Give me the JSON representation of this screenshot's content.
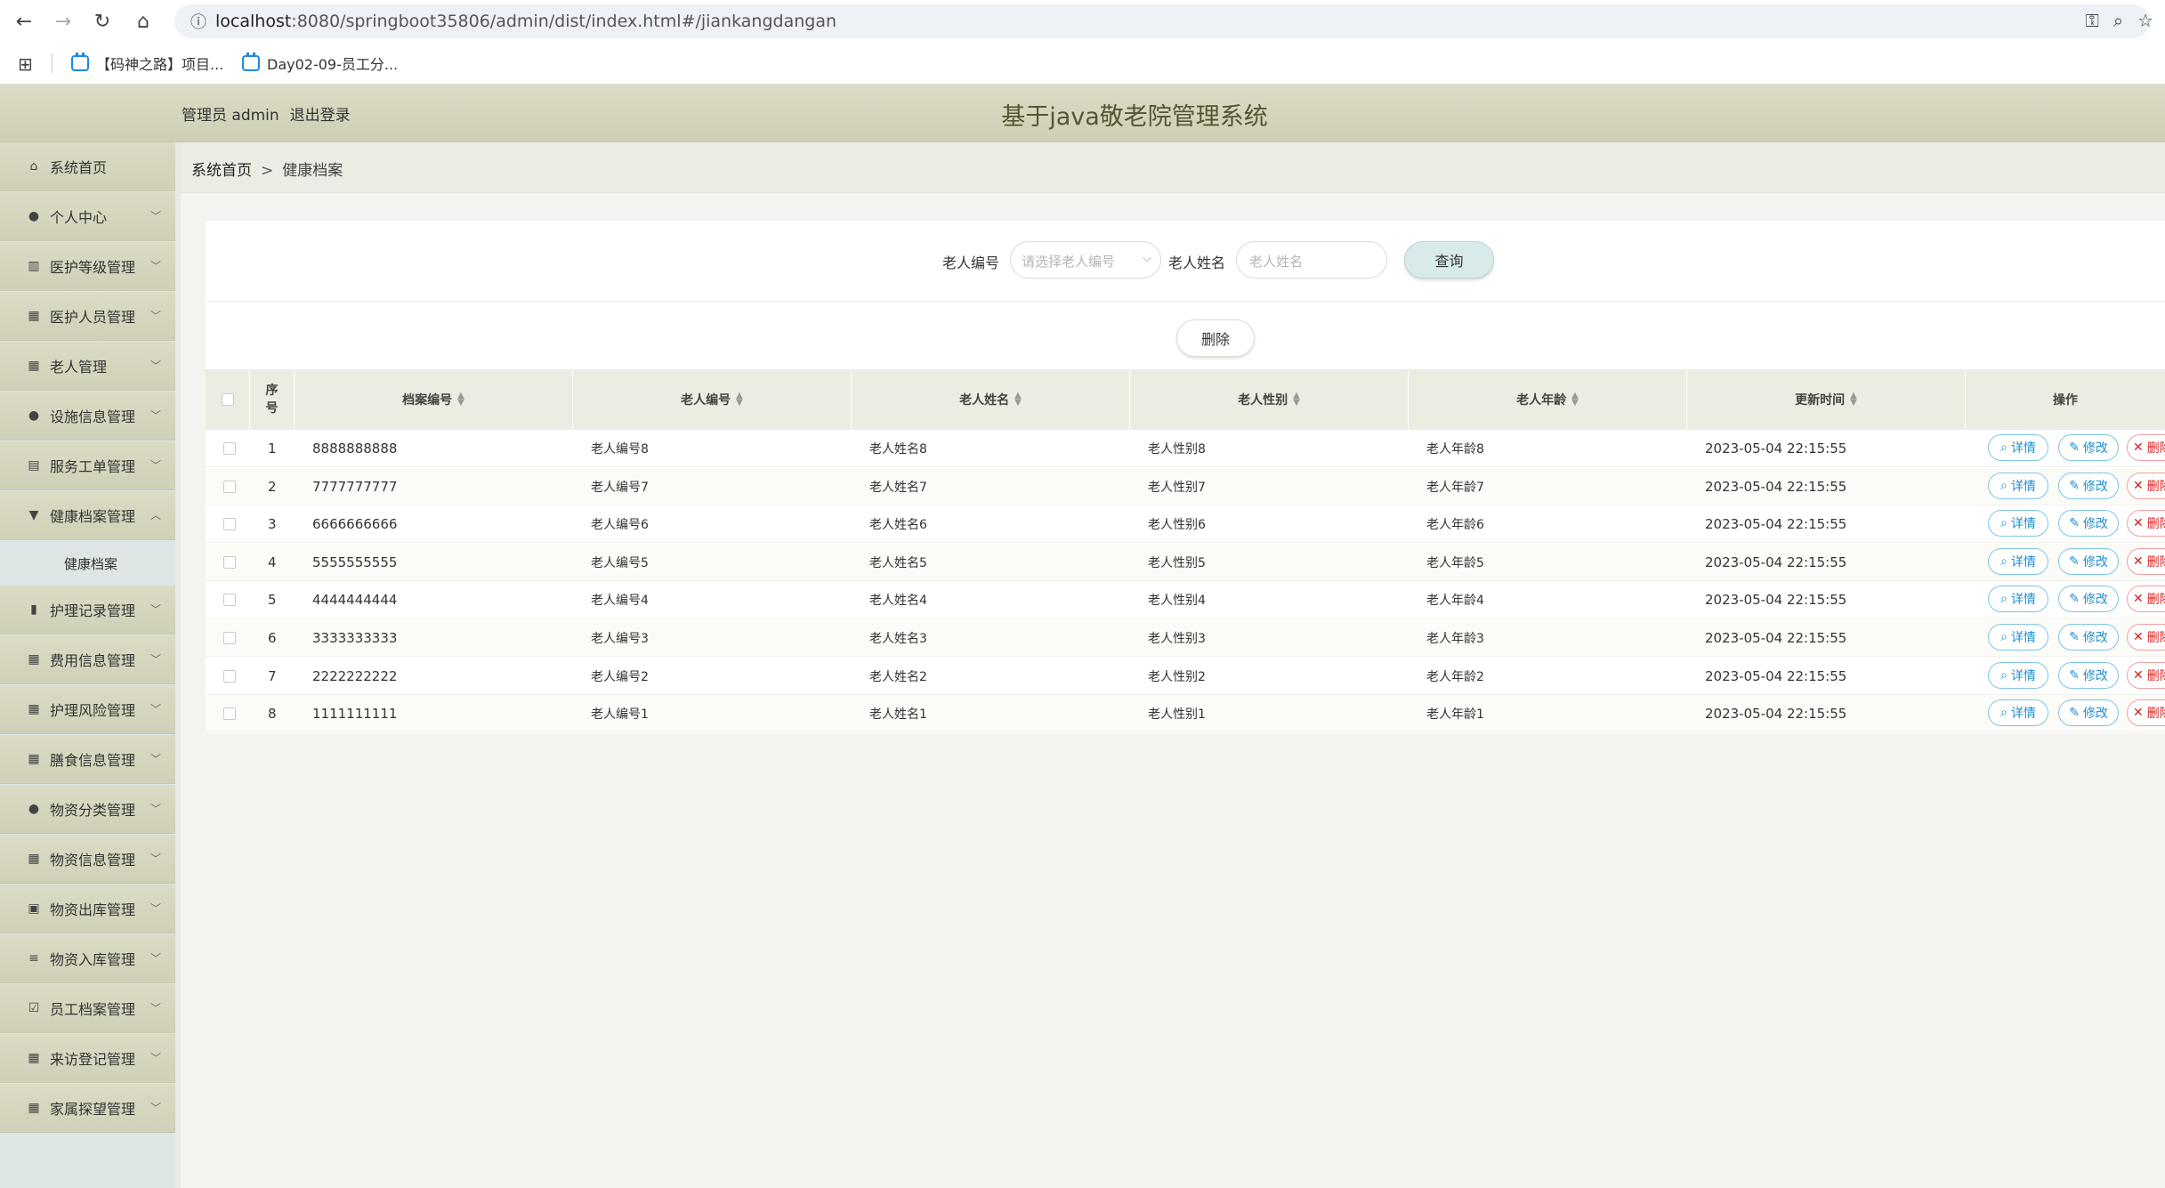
{
  "browser": {
    "url_host": "localhost",
    "url_rest": ":8080/springboot35806/admin/dist/index.html#/jiankangdangan",
    "bookmarks": [
      "【码神之路】项目...",
      "Day02-09-员工分..."
    ]
  },
  "header": {
    "user_role": "管理员 admin",
    "logout": "退出登录",
    "title": "基于java敬老院管理系统"
  },
  "sidebar": {
    "items": [
      {
        "label": "系统首页",
        "icon": "home-icon",
        "expandable": false
      },
      {
        "label": "个人中心",
        "icon": "user-icon",
        "expandable": true
      },
      {
        "label": "医护等级管理",
        "icon": "chart-icon",
        "expandable": true
      },
      {
        "label": "医护人员管理",
        "icon": "grid-icon",
        "expandable": true
      },
      {
        "label": "老人管理",
        "icon": "grid-icon",
        "expandable": true
      },
      {
        "label": "设施信息管理",
        "icon": "user-icon",
        "expandable": true
      },
      {
        "label": "服务工单管理",
        "icon": "clipboard-icon",
        "expandable": true
      },
      {
        "label": "健康档案管理",
        "icon": "cup-icon",
        "expandable": true,
        "expanded": true
      },
      {
        "label": "护理记录管理",
        "icon": "bar-chart-icon",
        "expandable": true
      },
      {
        "label": "费用信息管理",
        "icon": "grid-icon",
        "expandable": true
      },
      {
        "label": "护理风险管理",
        "icon": "grid-icon",
        "expandable": true
      },
      {
        "label": "膳食信息管理",
        "icon": "grid-icon",
        "expandable": true
      },
      {
        "label": "物资分类管理",
        "icon": "user-icon",
        "expandable": true
      },
      {
        "label": "物资信息管理",
        "icon": "grid-icon",
        "expandable": true
      },
      {
        "label": "物资出库管理",
        "icon": "box-icon",
        "expandable": true
      },
      {
        "label": "物资入库管理",
        "icon": "list-icon",
        "expandable": true
      },
      {
        "label": "员工档案管理",
        "icon": "check-icon",
        "expandable": true
      },
      {
        "label": "来访登记管理",
        "icon": "grid-icon",
        "expandable": true
      },
      {
        "label": "家属探望管理",
        "icon": "grid-icon",
        "expandable": true
      }
    ],
    "submenu_label": "健康档案"
  },
  "breadcrumb": {
    "home": "系统首页",
    "separator": ">",
    "current": "健康档案"
  },
  "search": {
    "elder_no_label": "老人编号",
    "elder_no_placeholder": "请选择老人编号",
    "elder_name_label": "老人姓名",
    "elder_name_placeholder": "老人姓名",
    "query_button": "查询"
  },
  "toolbar": {
    "delete_button": "删除"
  },
  "table": {
    "headers": {
      "index": "序号",
      "record_no": "档案编号",
      "elder_no": "老人编号",
      "elder_name": "老人姓名",
      "elder_gender": "老人性别",
      "elder_age": "老人年龄",
      "update_time": "更新时间",
      "actions": "操作"
    },
    "action_labels": {
      "detail": "详情",
      "edit": "修改",
      "delete": "删除"
    },
    "rows": [
      {
        "index": "1",
        "record_no": "8888888888",
        "elder_no": "老人编号8",
        "elder_name": "老人姓名8",
        "elder_gender": "老人性别8",
        "elder_age": "老人年龄8",
        "update_time": "2023-05-04 22:15:55"
      },
      {
        "index": "2",
        "record_no": "7777777777",
        "elder_no": "老人编号7",
        "elder_name": "老人姓名7",
        "elder_gender": "老人性别7",
        "elder_age": "老人年龄7",
        "update_time": "2023-05-04 22:15:55"
      },
      {
        "index": "3",
        "record_no": "6666666666",
        "elder_no": "老人编号6",
        "elder_name": "老人姓名6",
        "elder_gender": "老人性别6",
        "elder_age": "老人年龄6",
        "update_time": "2023-05-04 22:15:55"
      },
      {
        "index": "4",
        "record_no": "5555555555",
        "elder_no": "老人编号5",
        "elder_name": "老人姓名5",
        "elder_gender": "老人性别5",
        "elder_age": "老人年龄5",
        "update_time": "2023-05-04 22:15:55"
      },
      {
        "index": "5",
        "record_no": "4444444444",
        "elder_no": "老人编号4",
        "elder_name": "老人姓名4",
        "elder_gender": "老人性别4",
        "elder_age": "老人年龄4",
        "update_time": "2023-05-04 22:15:55"
      },
      {
        "index": "6",
        "record_no": "3333333333",
        "elder_no": "老人编号3",
        "elder_name": "老人姓名3",
        "elder_gender": "老人性别3",
        "elder_age": "老人年龄3",
        "update_time": "2023-05-04 22:15:55"
      },
      {
        "index": "7",
        "record_no": "2222222222",
        "elder_no": "老人编号2",
        "elder_name": "老人姓名2",
        "elder_gender": "老人性别2",
        "elder_age": "老人年龄2",
        "update_time": "2023-05-04 22:15:55"
      },
      {
        "index": "8",
        "record_no": "1111111111",
        "elder_no": "老人编号1",
        "elder_name": "老人姓名1",
        "elder_gender": "老人性别1",
        "elder_age": "老人年龄1",
        "update_time": "2023-05-04 22:15:55"
      }
    ]
  }
}
